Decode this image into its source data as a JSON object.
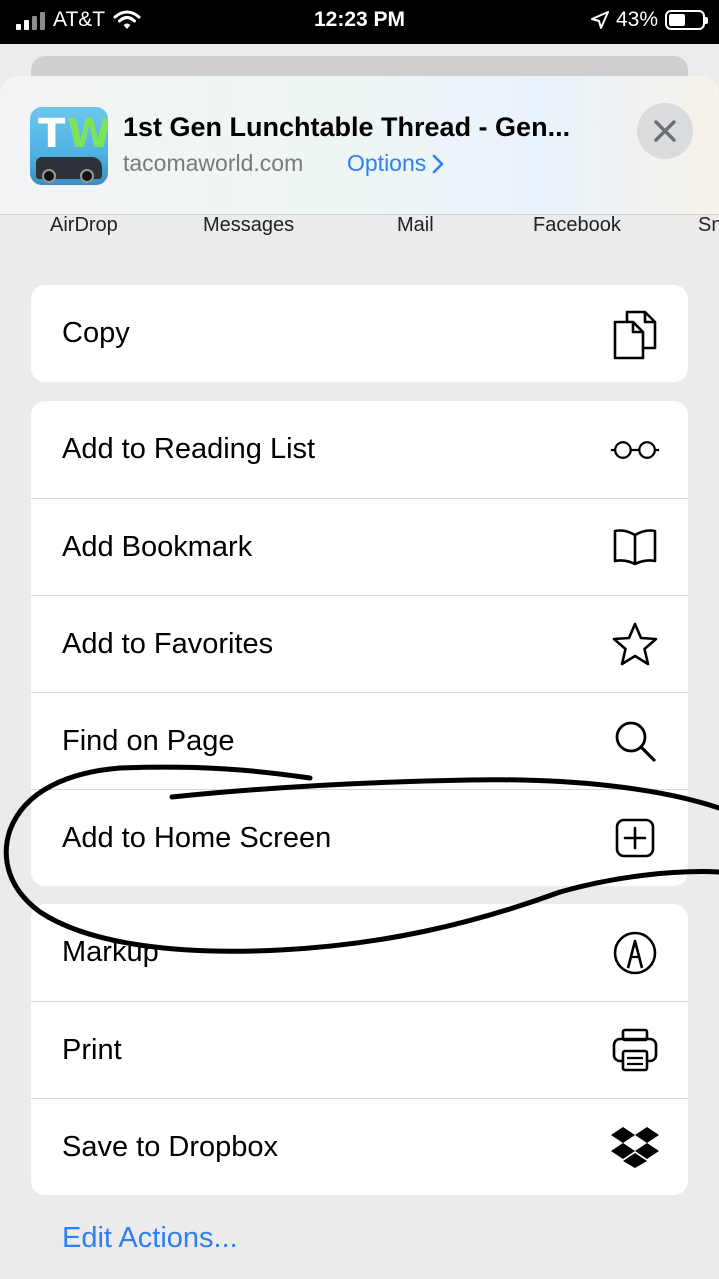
{
  "status_bar": {
    "carrier": "AT&T",
    "time": "12:23 PM",
    "battery": "43%"
  },
  "share_header": {
    "icon_text": "TW",
    "title": "1st Gen Lunchtable Thread - Gen...",
    "domain": "tacomaworld.com",
    "options_label": "Options"
  },
  "apps": [
    "AirDrop",
    "Messages",
    "Mail",
    "Facebook",
    "Sn"
  ],
  "groups": {
    "copy": {
      "label": "Copy",
      "icon": "copy-icon"
    },
    "reading": [
      {
        "label": "Add to Reading List",
        "icon": "glasses-icon"
      },
      {
        "label": "Add Bookmark",
        "icon": "book-icon"
      },
      {
        "label": "Add to Favorites",
        "icon": "star-icon"
      },
      {
        "label": "Find on Page",
        "icon": "magnifier-icon"
      },
      {
        "label": "Add to Home Screen",
        "icon": "plus-square-icon"
      }
    ],
    "more": [
      {
        "label": "Markup",
        "icon": "markup-pen-icon"
      },
      {
        "label": "Print",
        "icon": "printer-icon"
      },
      {
        "label": "Save to Dropbox",
        "icon": "dropbox-icon"
      }
    ]
  },
  "edit_actions_label": "Edit Actions...",
  "colors": {
    "accent": "#2f7ff2",
    "annotation": "#000000"
  }
}
